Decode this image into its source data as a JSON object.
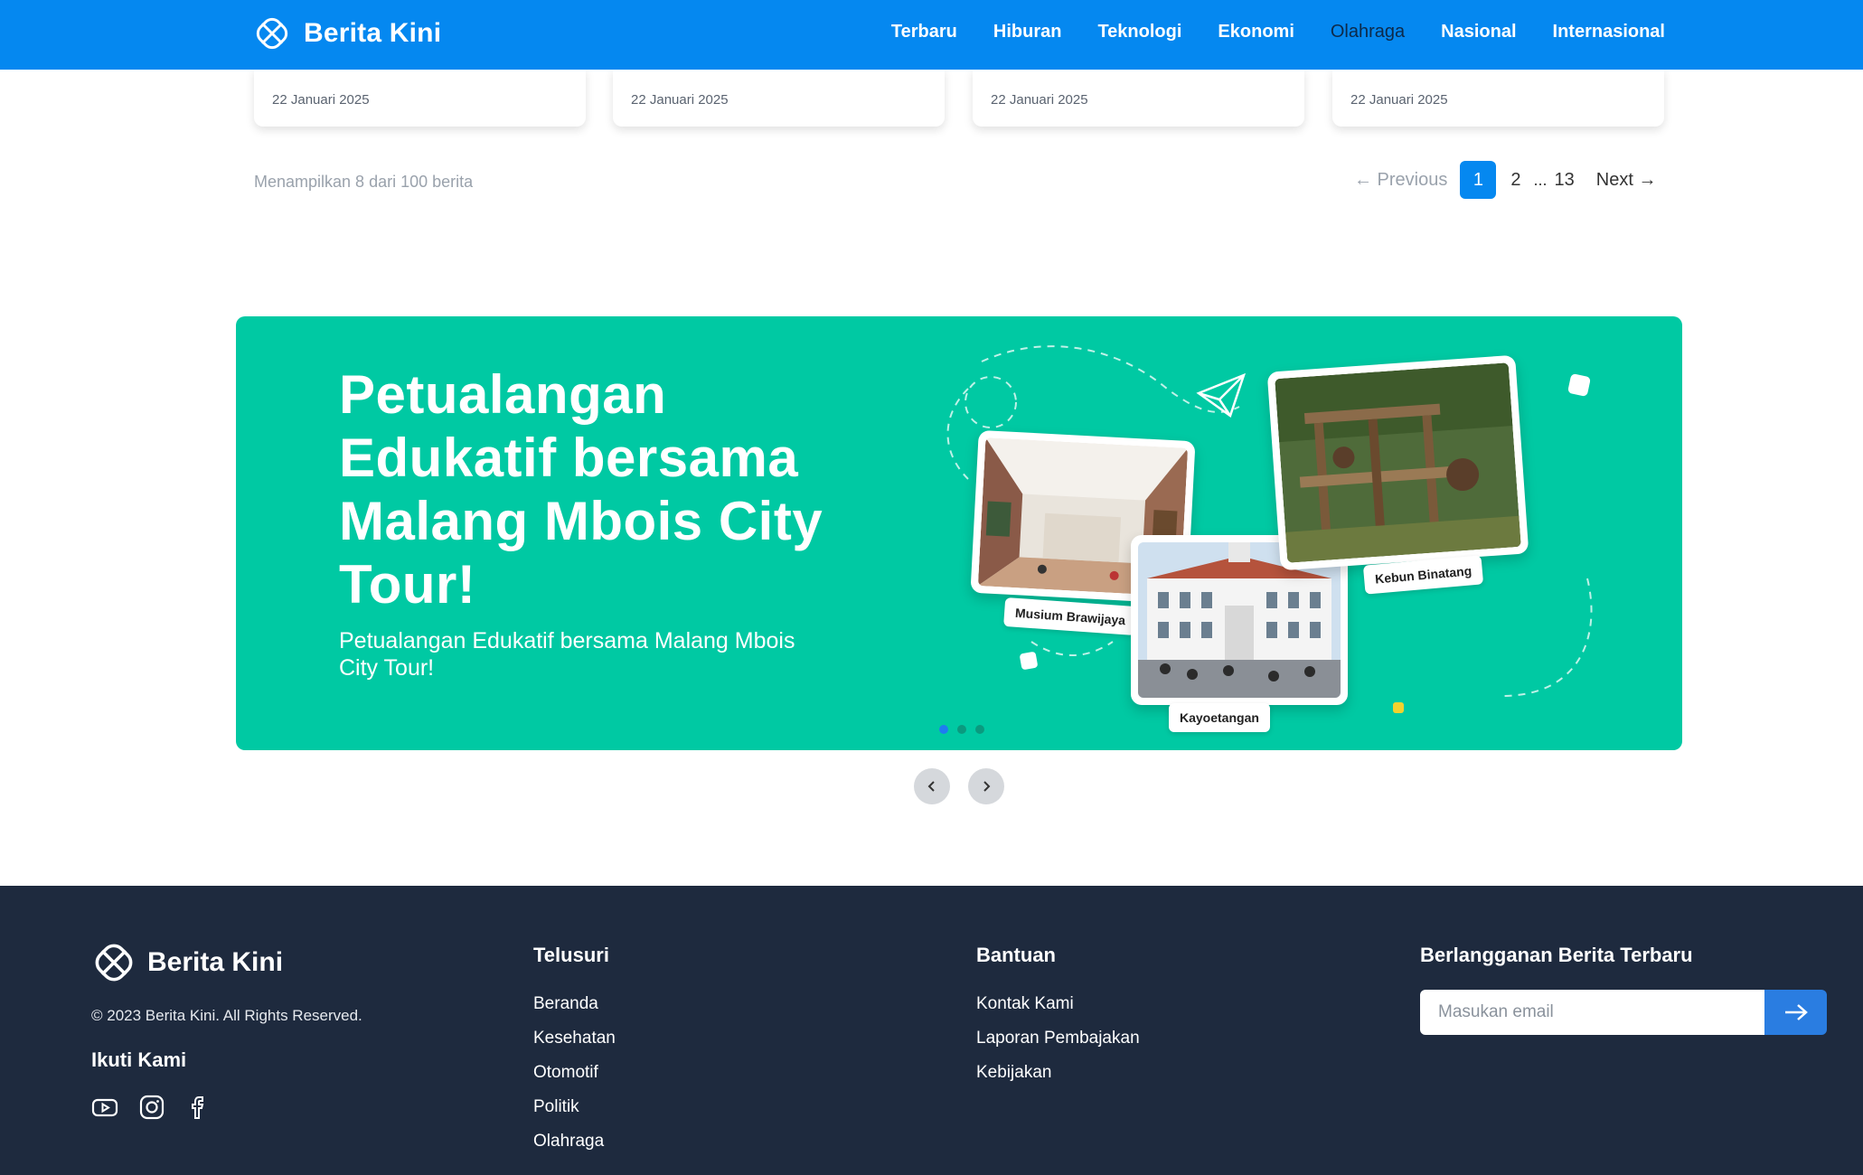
{
  "navbar": {
    "brand": "Berita Kini",
    "links": [
      "Terbaru",
      "Hiburan",
      "Teknologi",
      "Ekonomi",
      "Olahraga",
      "Nasional",
      "Internasional"
    ],
    "active_link": "Olahraga"
  },
  "cards": [
    {
      "date": "22 Januari 2025"
    },
    {
      "date": "22 Januari 2025"
    },
    {
      "date": "22 Januari 2025"
    },
    {
      "date": "22 Januari 2025"
    }
  ],
  "pagination": {
    "info": "Menampilkan 8 dari 100 berita",
    "prev": "← Previous",
    "current": "1",
    "second": "2",
    "dots": "...",
    "last": "13",
    "next": "Next →"
  },
  "banner": {
    "title": "Petualangan Edukatif bersama Malang Mbois City Tour!",
    "subtitle": "Petualangan Edukatif bersama Malang Mbois City Tour!",
    "photo_labels": [
      "Musium Brawijaya",
      "Kayoetangan",
      "Kebun Binatang"
    ],
    "slide_count": 3,
    "active_slide": 0
  },
  "footer": {
    "brand": "Berita Kini",
    "copyright": "© 2023 Berita Kini. All Rights Reserved.",
    "follow_title": "Ikuti Kami",
    "social_icons": [
      "youtube-icon",
      "instagram-icon",
      "facebook-icon"
    ],
    "explore": {
      "title": "Telusuri",
      "links": [
        "Beranda",
        "Kesehatan",
        "Otomotif",
        "Politik",
        "Olahraga"
      ]
    },
    "help": {
      "title": "Bantuan",
      "links": [
        "Kontak Kami",
        "Laporan Pembajakan",
        "Kebijakan"
      ]
    },
    "subscribe": {
      "title": "Berlangganan Berita Terbaru",
      "placeholder": "Masukan email"
    }
  },
  "colors": {
    "primary": "#0588f0",
    "banner": "#00c9a3",
    "footer": "#1e2a3e"
  }
}
